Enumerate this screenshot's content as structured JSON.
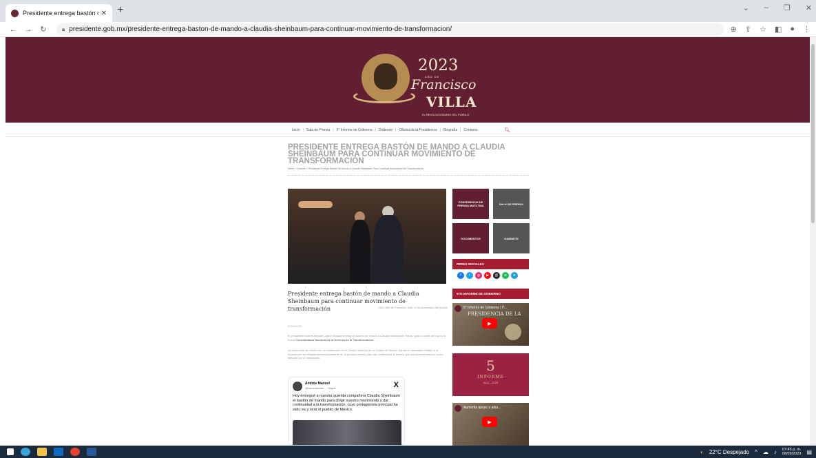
{
  "browser": {
    "tab_title": "Presidente entrega bastón de m",
    "url": "presidente.gob.mx/presidente-entrega-baston-de-mando-a-claudia-sheinbaum-para-continuar-movimiento-de-transformacion/"
  },
  "logo": {
    "year": "2023",
    "small": "AÑO DE",
    "name": "Francisco",
    "villa": "VILLA",
    "tagline": "EL REVOLUCIONARIO DEL PUEBLO"
  },
  "menu": {
    "items": [
      "Inicio",
      "Sala de Prensa",
      "5° Informe de Gobierno",
      "Gabinete",
      "Oficina de la Presidencia",
      "Biografía",
      "Contacto"
    ]
  },
  "article": {
    "headline": "PRESIDENTE ENTREGA BASTÓN DE MANDO A CLAUDIA SHEINBAUM PARA CONTINUAR MOVIMIENTO DE TRANSFORMACIÓN",
    "breadcrumbs": "Home  >  Noticias  >  Presidente Entrega Bastón De Mando A Claudia Sheinbaum Para Continuar Movimiento De Transformación",
    "caption_title": "Presidente entrega bastón de mando a Claudia Sheinbaum para continuar movimiento de transformación",
    "caption_sub": "2023 Año de Francisco Villa, el revolucionario del pueblo",
    "date": "07/09/2023",
    "para1_start": "El presidente Andrés Manuel López Obrador entregó el bastón de mando a Claudia Sheinbaum Pardo, quien a partir de hoy es la nueva ",
    "para1_bold": "Coordinadora Nacional de la Defensa de la Transformación",
    "para2": "La ceremonia se celebró en un restaurante en el Centro Histórico de la Ciudad de México, donde el mandatario festejó a la doctora por ser elegida democráticamente en el proceso interno para dar continuidad al cambio que actualmente está en curso, liderado por el mandatario."
  },
  "tweet": {
    "author": "Andrés Manuel",
    "handle": "@lopezobrador_ · Seguir",
    "text": "Hoy entregué a nuestra querida compañera Claudia Sheinbaum el bastón de mando para dirigir nuestro movimiento y dar continuidad a la transformación, cuyo protagonista principal ha sido, es y será el pueblo de México."
  },
  "sidebar": {
    "tiles": [
      "CONFERENCIA DE PRENSA MATUTINA",
      "SALA DE PRENSA",
      "DOCUMENTOS",
      "GABINETE"
    ],
    "social_head": "REDES SOCIALES",
    "socials": [
      {
        "name": "facebook-icon",
        "color": "#1877f2",
        "glyph": "f"
      },
      {
        "name": "twitter-icon",
        "color": "#1da1f2",
        "glyph": "t"
      },
      {
        "name": "instagram-icon",
        "color": "#e1306c",
        "glyph": "◎"
      },
      {
        "name": "youtube-icon",
        "color": "#ff0000",
        "glyph": "▶"
      },
      {
        "name": "threads-icon",
        "color": "#222222",
        "glyph": "@"
      },
      {
        "name": "spotify-icon",
        "color": "#1db954",
        "glyph": "≋"
      },
      {
        "name": "telegram-icon",
        "color": "#229ed9",
        "glyph": "➤"
      }
    ],
    "informe_head": "5TO INFORME DE GOBIERNO",
    "video1_title": "5° Informe de Gobierno | P...",
    "video1_overlay": "PRESIDENCIA DE LA",
    "informe_num": "5",
    "informe_label": "INFORME",
    "informe_years": "2022 - 2023",
    "video2_title": "Aumenta apoyo a adul..."
  },
  "taskbar": {
    "weather": "22°C  Despejado",
    "time": "07:45 p. m.",
    "date": "08/09/2023"
  }
}
